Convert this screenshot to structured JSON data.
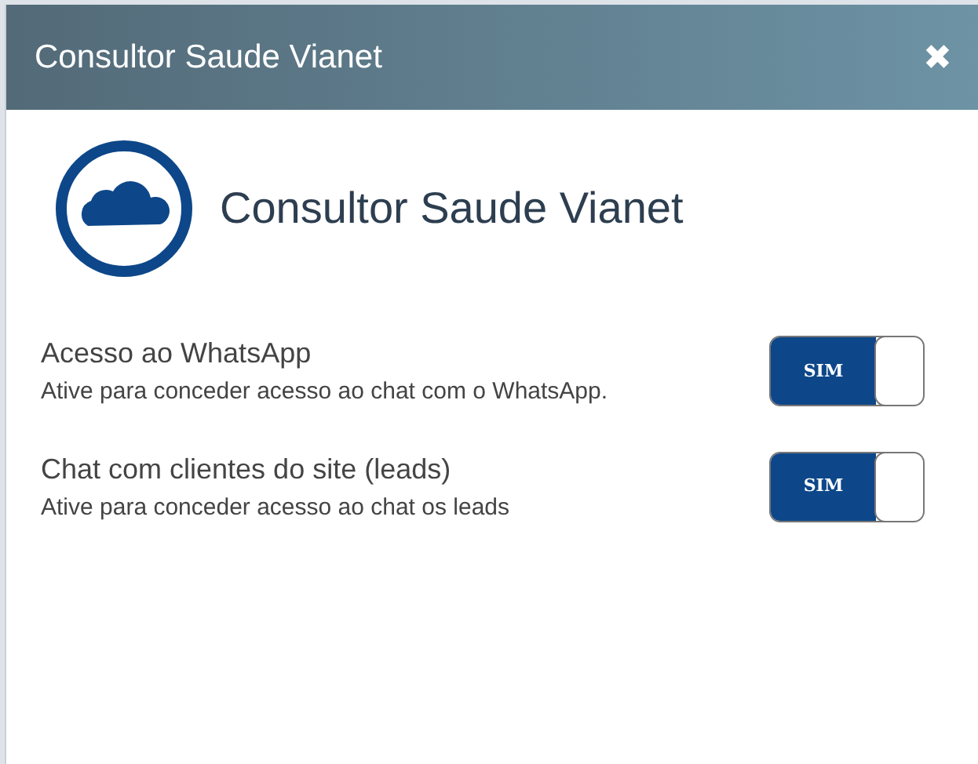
{
  "window": {
    "title": "Consultor Saude Vianet",
    "close": "✖"
  },
  "heading": "Consultor Saude Vianet",
  "settings": [
    {
      "label": "Acesso ao WhatsApp",
      "description": "Ative para conceder acesso ao chat com o WhatsApp.",
      "on": true,
      "switch_text": "SIM"
    },
    {
      "label": "Chat com clientes do site (leads)",
      "description": "Ative para conceder acesso ao chat os leads",
      "on": true,
      "switch_text": "SIM"
    }
  ]
}
